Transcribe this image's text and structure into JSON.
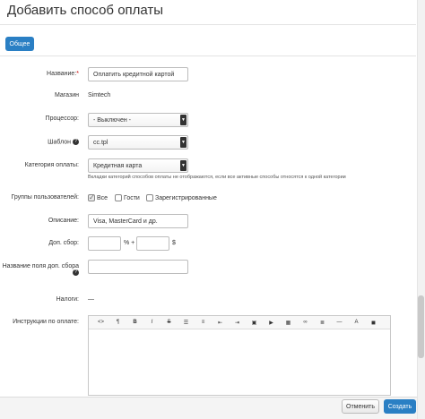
{
  "title": "Добавить способ оплаты",
  "tabs": {
    "general": "Общее"
  },
  "form": {
    "name_label": "Название:",
    "name_required_mark": "*",
    "name_value": "Оплатить кредитной картой",
    "store_label": "Магазин",
    "store_value": "Simtech",
    "processor_label": "Процессор:",
    "processor_value": "- Выключен -",
    "template_label": "Шаблон",
    "template_value": "cc.tpl",
    "category_label": "Категория оплаты:",
    "category_value": "Кредитная карта",
    "category_hint": "Вкладки категорий способов оплаты не отображаются, если все активные способы относятся к одной категории",
    "groups_label": "Группы пользователей:",
    "groups": [
      "Все",
      "Гости",
      "Зарегистрированные"
    ],
    "description_label": "Описание:",
    "description_value": "Visa, MasterCard и др.",
    "surcharge_label": "Доп. сбор:",
    "surcharge_percent_unit": "% +",
    "surcharge_currency_unit": "$",
    "surcharge_title_label": "Название поля доп. сбора",
    "taxes_label": "Налоги:",
    "taxes_value": "—",
    "instructions_label": "Инструкции по оплате:"
  },
  "editor_toolbar": [
    "code-icon",
    "paragraph-icon",
    "bold-icon",
    "italic-icon",
    "strikethrough-icon",
    "unordered-list-icon",
    "ordered-list-icon",
    "outdent-icon",
    "indent-icon",
    "image-icon",
    "video-icon",
    "table-icon",
    "link-icon",
    "align-icon",
    "horizontal-rule-icon",
    "font-color-icon",
    "format-icon"
  ],
  "footer": {
    "cancel": "Отменить",
    "create": "Создать"
  },
  "colors": {
    "primary": "#2a7fc4",
    "required": "#cc0000"
  }
}
